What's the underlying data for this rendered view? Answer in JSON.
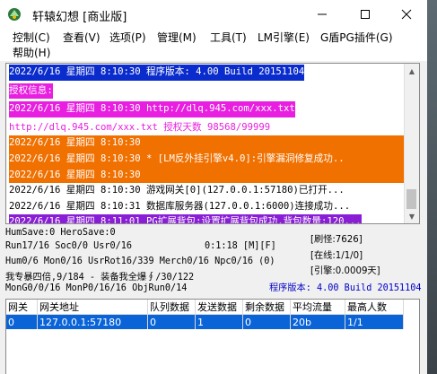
{
  "window": {
    "title": "轩辕幻想 [商业版]"
  },
  "menu": [
    "控制(C)",
    "查看(V)",
    "选项(P)",
    "管理(M)",
    "工具(T)",
    "LM引擎(E)",
    "G盾PG插件(G)",
    "帮助(H)"
  ],
  "log": [
    {
      "text": "2022/6/16 星期四 8:10:30 程序版本: 4.00 Build 20151104",
      "style": "blue"
    },
    {
      "text": "授权信息:",
      "style": "mag"
    },
    {
      "text": "2022/6/16 星期四 8:10:30 http://dlq.945.com/xxx.txt",
      "style": "mag"
    },
    {
      "text": "http://dlq.945.com/xxx.txt 授权天数 98568/99999",
      "style": "pinktext"
    },
    {
      "text": "2022/6/16 星期四 8:10:30",
      "style": "orange"
    },
    {
      "text": "2022/6/16 星期四 8:10:30 * [LM反外挂引擎v4.0]:引擎漏洞修复成功..",
      "style": "orange"
    },
    {
      "text": "2022/6/16 星期四 8:10:30",
      "style": "orange"
    },
    {
      "text": "2022/6/16 星期四 8:10:30 游戏网关[0](127.0.0.1:57180)已打开...",
      "style": "plain"
    },
    {
      "text": "2022/6/16 星期四 8:10:31 数据库服务器(127.0.0.1:6000)连接成功...",
      "style": "plain"
    },
    {
      "text": "2022/6/16 星期四 8:11:01 PG扩展背包:设置扩展背包成功,背包数量:120...",
      "style": "purple"
    }
  ],
  "stats": {
    "line1": "HumSave:0 HeroSave:0",
    "line2": "Run17/16 Soc0/0 Usr0/16",
    "timer": "0:1:18 [M][F]",
    "line3": "Hum0/6 Mon0/16 UsrRot16/339 Merch0/16 Npc0/16 (0)",
    "line4": "我专暴四倍,9/184 - 装备我全爆∮/30/122",
    "line5": "MonG0/0/16 MonP0/16/16 ObjRun0/14",
    "refresh": "[刷怪:7626]",
    "online": "[在线:1/1/0]",
    "engine": "[引擎:0.0009天]",
    "version": "程序版本: 4.00 Build 20151104"
  },
  "grid": {
    "headers": [
      "网关",
      "网关地址",
      "队列数据",
      "发送数据",
      "剩余数据",
      "平均流量",
      "最高人数"
    ],
    "rows": [
      [
        "0",
        "127.0.0.1:57180",
        "0",
        "1",
        "0",
        "20b",
        "1/1"
      ]
    ]
  },
  "colors": {
    "log_blue": "#0b2ccc",
    "log_magenta": "#e81ee0",
    "log_orange": "#f07000",
    "log_purple": "#8a1ed6",
    "selection": "#0a64d8",
    "version_text": "#0000c8"
  },
  "icons": {
    "app": "app-icon",
    "minimize": "minimize-icon",
    "maximize": "maximize-icon",
    "close": "close-icon"
  }
}
